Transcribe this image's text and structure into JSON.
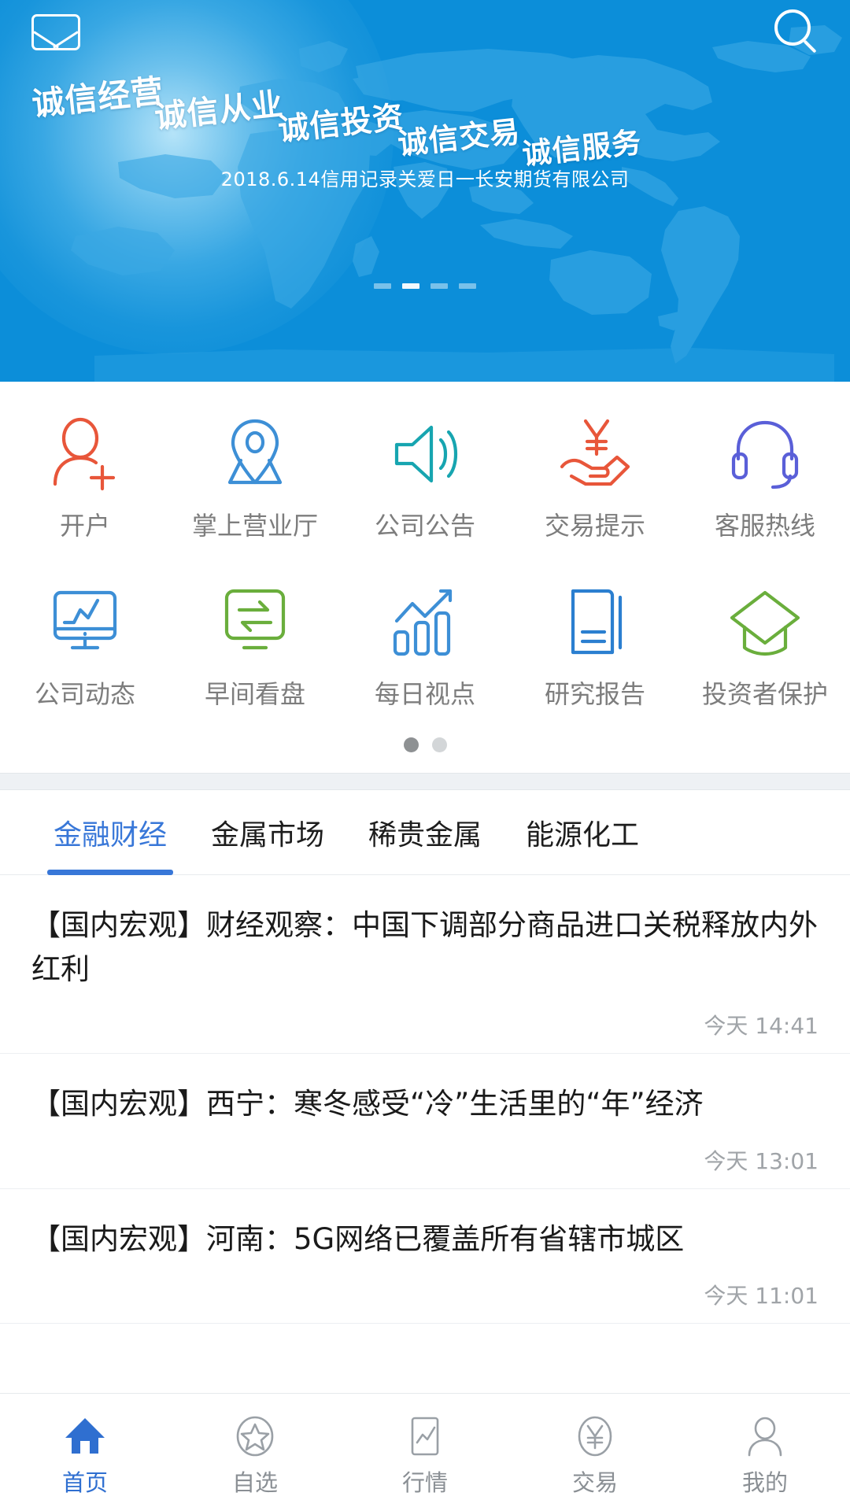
{
  "banner": {
    "mail_icon": "mail-icon",
    "search_icon": "search-icon",
    "slogans": [
      "诚信经营",
      "诚信从业",
      "诚信投资",
      "诚信交易",
      "诚信服务"
    ],
    "caption": "2018.6.14信用记录关爱日一长安期货有限公司",
    "dots_total": 4,
    "dots_active_index": 1,
    "bg_color": "#0c8ed9"
  },
  "grid": {
    "rows": [
      [
        {
          "label": "开户",
          "icon": "user-add-icon",
          "color": "#e8563a"
        },
        {
          "label": "掌上营业厅",
          "icon": "location-pin-icon",
          "color": "#3d8fd6"
        },
        {
          "label": "公司公告",
          "icon": "speaker-icon",
          "color": "#17a5b0"
        },
        {
          "label": "交易提示",
          "icon": "hand-yen-icon",
          "color": "#e8563a"
        },
        {
          "label": "客服热线",
          "icon": "headset-icon",
          "color": "#5a5fd8"
        }
      ],
      [
        {
          "label": "公司动态",
          "icon": "monitor-chart-icon",
          "color": "#3d8fd6"
        },
        {
          "label": "早间看盘",
          "icon": "exchange-screen-icon",
          "color": "#6aae3c"
        },
        {
          "label": "每日视点",
          "icon": "bar-growth-icon",
          "color": "#3d8fd6"
        },
        {
          "label": "研究报告",
          "icon": "book-icon",
          "color": "#2b7fd0"
        },
        {
          "label": "投资者保护",
          "icon": "graduation-cap-icon",
          "color": "#6aae3c"
        }
      ]
    ],
    "dots_total": 2,
    "dots_active_index": 0
  },
  "news": {
    "tabs": [
      {
        "label": "金融财经",
        "active": true
      },
      {
        "label": "金属市场",
        "active": false
      },
      {
        "label": "稀贵金属",
        "active": false
      },
      {
        "label": "能源化工",
        "active": false
      }
    ],
    "active_color": "#3877d8",
    "items": [
      {
        "title": "【国内宏观】财经观察：中国下调部分商品进口关税释放内外红利",
        "time": "今天 14:41"
      },
      {
        "title": "【国内宏观】西宁：寒冬感受“冷”生活里的“年”经济",
        "time": "今天 13:01"
      },
      {
        "title": "【国内宏观】河南：5G网络已覆盖所有省辖市城区",
        "time": "今天 11:01"
      }
    ]
  },
  "bottom_nav": {
    "active_color": "#2f6fd0",
    "items": [
      {
        "label": "首页",
        "icon": "home-icon",
        "active": true
      },
      {
        "label": "自选",
        "icon": "star-circle-icon",
        "active": false
      },
      {
        "label": "行情",
        "icon": "quote-chart-icon",
        "active": false
      },
      {
        "label": "交易",
        "icon": "yen-circle-icon",
        "active": false
      },
      {
        "label": "我的",
        "icon": "person-icon",
        "active": false
      }
    ]
  }
}
